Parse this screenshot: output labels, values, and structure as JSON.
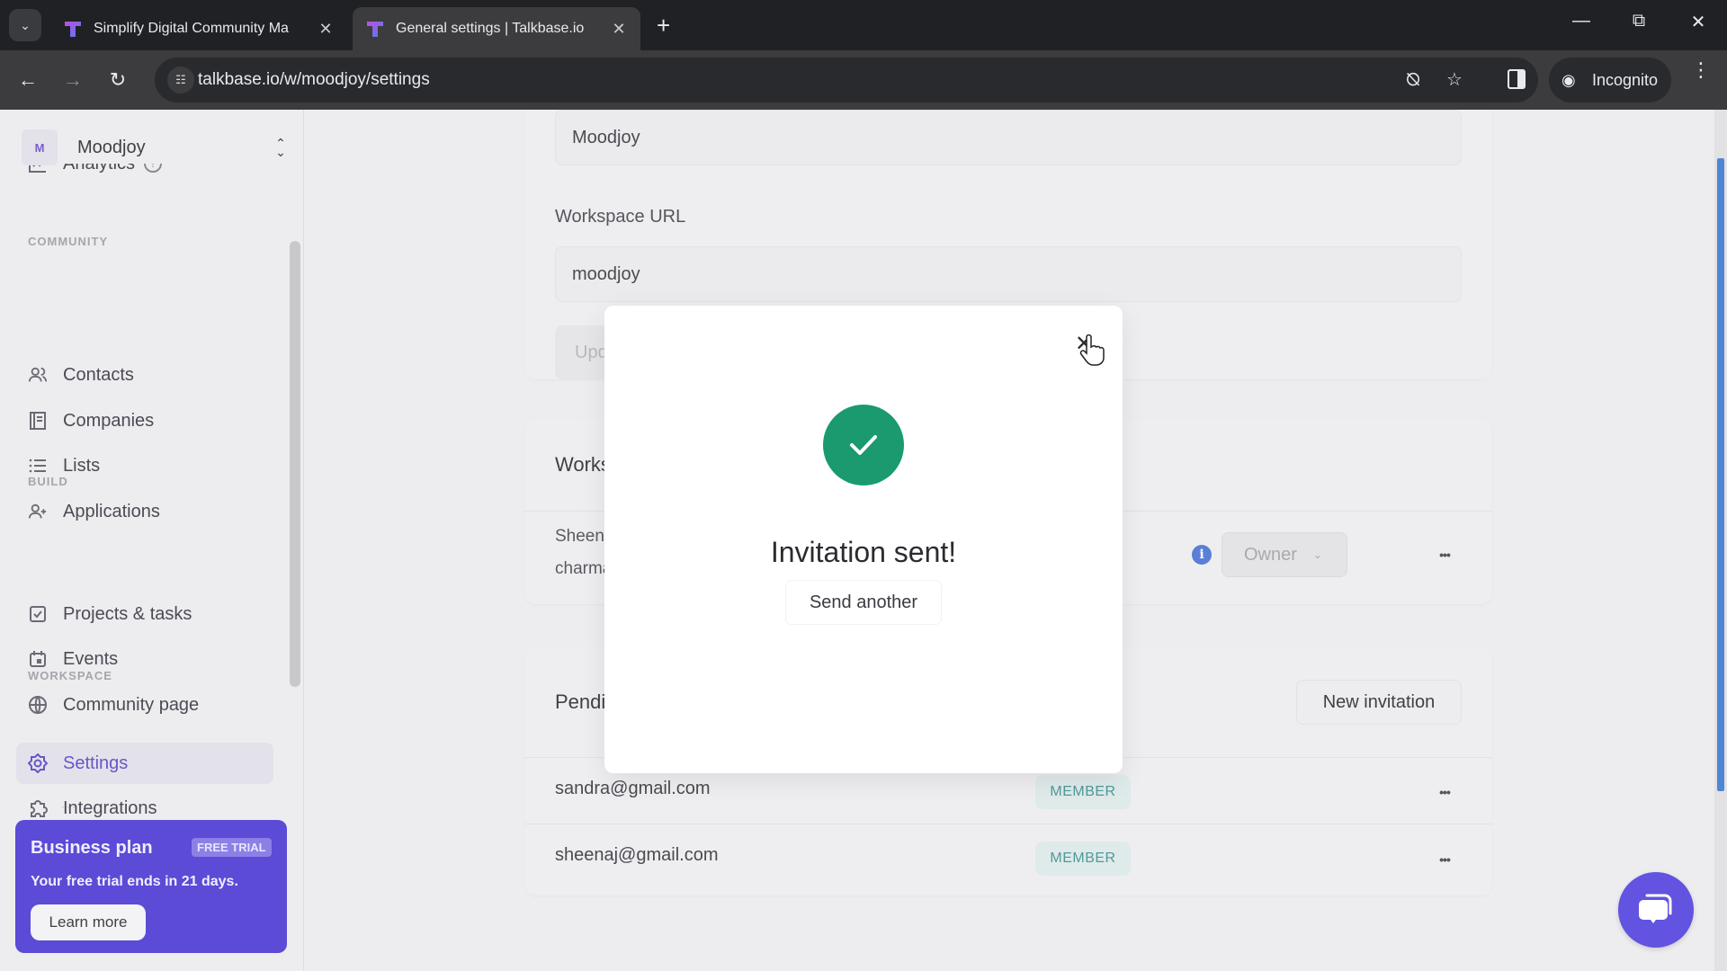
{
  "browser": {
    "tabs": [
      {
        "title": "Simplify Digital Community Ma",
        "active": false
      },
      {
        "title": "General settings | Talkbase.io",
        "active": true
      }
    ],
    "url": "talkbase.io/w/moodjoy/settings",
    "incognito_label": "Incognito",
    "icons": {
      "tab_list": "chevron-down-icon",
      "new_tab": "plus-icon",
      "back": "arrow-left-icon",
      "forward": "arrow-right-icon",
      "reload": "reload-icon",
      "site_info": "tune-icon",
      "eye_off": "eye-off-icon",
      "bookmark": "star-icon",
      "side_panel": "side-panel-icon",
      "menu": "kebab-icon"
    }
  },
  "sidebar": {
    "workspace": {
      "initial": "M",
      "name": "Moodjoy"
    },
    "partial_item": {
      "label": "Analytics",
      "icon": "chart-icon"
    },
    "sections": [
      {
        "label": "COMMUNITY",
        "items": [
          {
            "label": "Contacts",
            "icon": "contacts-icon"
          },
          {
            "label": "Companies",
            "icon": "building-icon"
          },
          {
            "label": "Lists",
            "icon": "list-icon"
          },
          {
            "label": "Applications",
            "icon": "user-plus-icon"
          }
        ]
      },
      {
        "label": "BUILD",
        "items": [
          {
            "label": "Projects & tasks",
            "icon": "checkbox-icon"
          },
          {
            "label": "Events",
            "icon": "calendar-icon"
          },
          {
            "label": "Community page",
            "icon": "globe-icon"
          }
        ]
      },
      {
        "label": "WORKSPACE",
        "items": [
          {
            "label": "Integrations",
            "icon": "puzzle-icon"
          },
          {
            "label": "Settings",
            "icon": "gear-icon",
            "active": true
          }
        ]
      }
    ],
    "plan": {
      "title": "Business plan",
      "badge": "FREE TRIAL",
      "text": "Your free trial ends in 21 days.",
      "button": "Learn more"
    }
  },
  "main": {
    "general": {
      "name_value": "Moodjoy",
      "url_label": "Workspace URL",
      "url_value": "moodjoy",
      "update_button": "Update"
    },
    "members": {
      "title": "Workspace members",
      "rows": [
        {
          "name": "Sheena",
          "email": "charmaine",
          "role": "Owner"
        }
      ]
    },
    "pending": {
      "title": "Pending invitations",
      "new_button": "New invitation",
      "rows": [
        {
          "email": "sandra@gmail.com",
          "role": "MEMBER"
        },
        {
          "email": "sheenaj@gmail.com",
          "role": "MEMBER"
        }
      ]
    }
  },
  "modal": {
    "title": "Invitation sent!",
    "button": "Send another",
    "success_color": "#1a9a6e"
  },
  "colors": {
    "accent": "#5b4bd6",
    "active_nav": "#6a55c9",
    "member_badge": "#4f9a98"
  }
}
